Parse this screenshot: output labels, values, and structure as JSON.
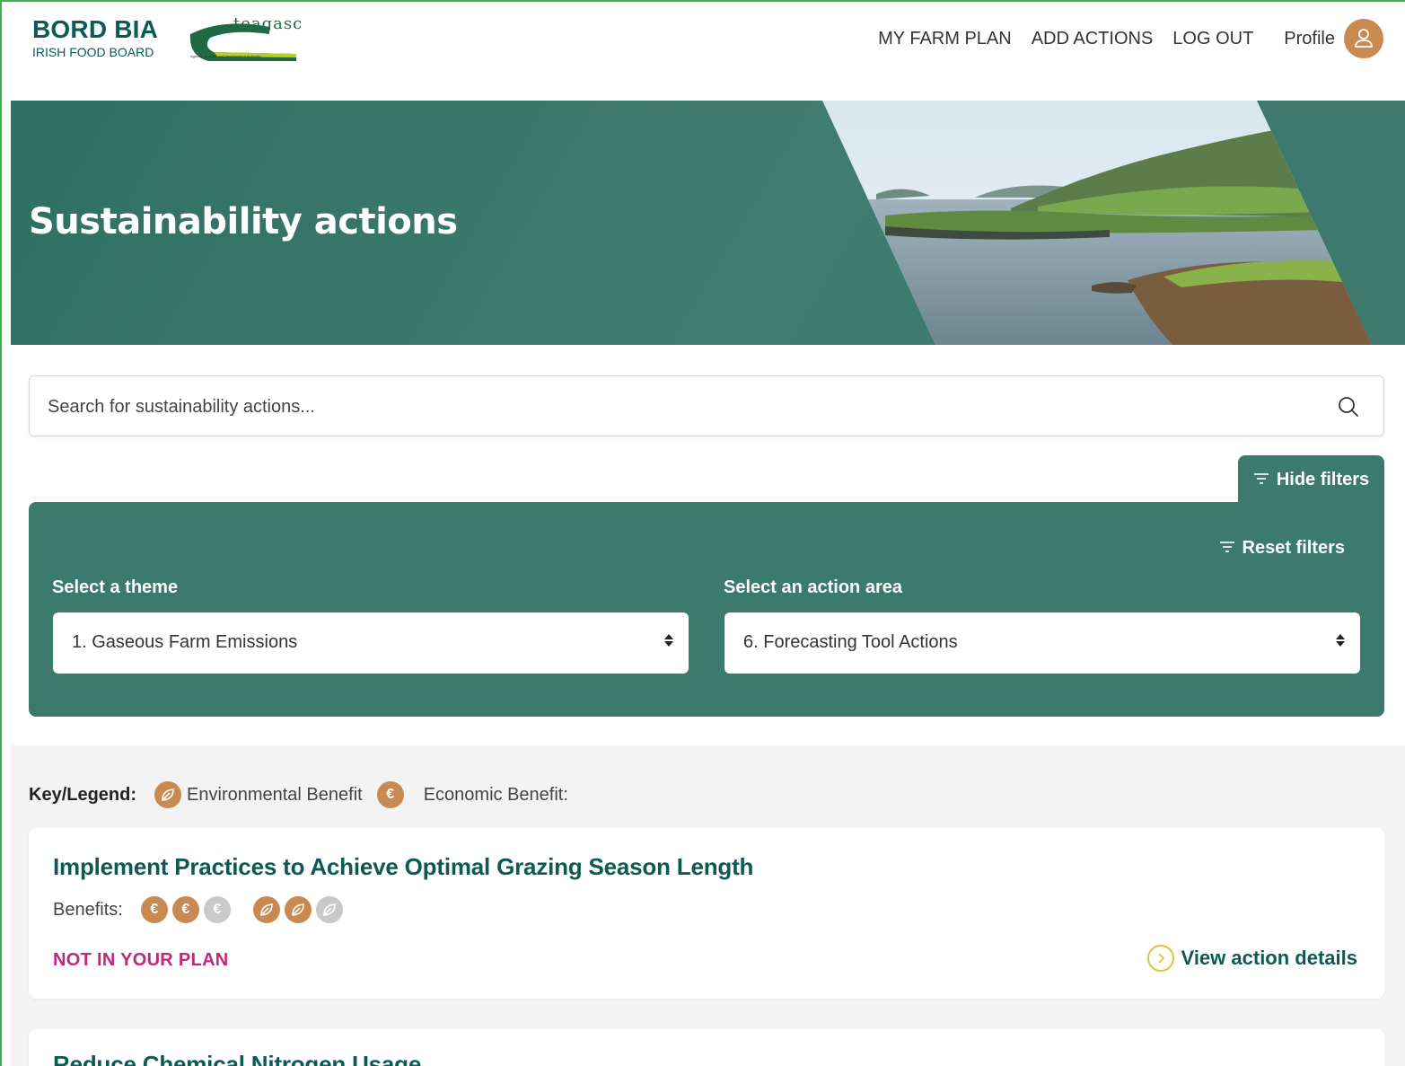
{
  "header": {
    "logo_bordbia_title": "BORD BIA",
    "logo_bordbia_sub": "IRISH FOOD BOARD",
    "logo_teagasc_text": "teagasc",
    "logo_teagasc_tagline": "Agriculture and Food Development Authority",
    "nav": {
      "my_farm_plan": "MY FARM PLAN",
      "add_actions": "ADD ACTIONS",
      "log_out": "LOG OUT",
      "profile": "Profile"
    }
  },
  "hero": {
    "title": "Sustainability actions"
  },
  "search": {
    "placeholder": "Search for sustainability actions..."
  },
  "filters": {
    "hide_label": "Hide filters",
    "reset_label": "Reset filters",
    "theme_label": "Select a theme",
    "theme_value": "1. Gaseous Farm Emissions",
    "area_label": "Select an action area",
    "area_value": "6. Forecasting Tool Actions"
  },
  "legend": {
    "label": "Key/Legend:",
    "environmental": "Environmental Benefit",
    "economic": "Economic Benefit:"
  },
  "actions": [
    {
      "title": "Implement Practices to Achieve Optimal Grazing Season Length",
      "benefits_label": "Benefits:",
      "economic_rating": 2,
      "environmental_rating": 2,
      "rating_max": 3,
      "status": "NOT IN YOUR PLAN",
      "view_label": "View action details"
    },
    {
      "title": "Reduce Chemical Nitrogen Usage"
    }
  ],
  "colors": {
    "brand_green": "#3d7a6e",
    "title_green": "#0d5a55",
    "coin_orange": "#c98a52",
    "status_pink": "#c0287a",
    "accent_yellow": "#e2c230"
  }
}
